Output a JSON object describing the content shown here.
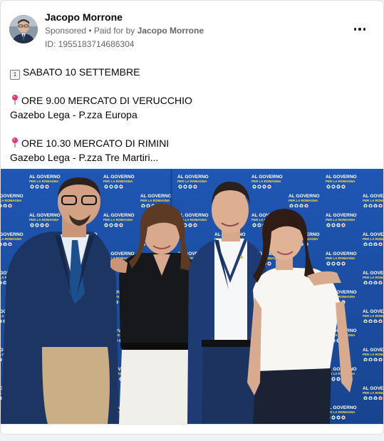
{
  "post": {
    "author": "Jacopo Morrone",
    "sponsored": "Sponsored",
    "paid_prefix": "• Paid for by",
    "paid_by": "Jacopo Morrone",
    "ad_id": "ID: 1955183714686304",
    "icons": {
      "date": "calendar-icon",
      "location": "pushpin-icon",
      "menu": "more-options-icon"
    },
    "lines": {
      "date": "SABATO 10 SETTEMBRE",
      "event1_title": "ORE 9.00 MERCATO DI VERUCCHIO",
      "event1_place": "Gazebo Lega - P.zza Europa",
      "event2_title": "ORE 10.30 MERCATO DI RIMINI",
      "event2_place": "Gazebo Lega - P.zza Tre Martiri..."
    },
    "calendar_icon_text": "1",
    "photo": {
      "backdrop_text_1": "AL GOVERNO",
      "backdrop_text_2": "PER LA ROMAGNA",
      "backdrop_color": "#1f57b4",
      "people_count": 4
    }
  }
}
